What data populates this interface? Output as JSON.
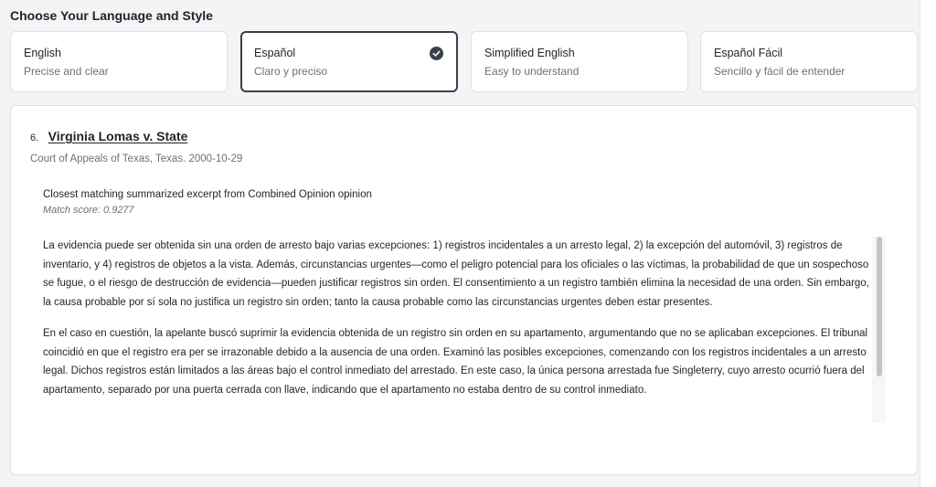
{
  "header": {
    "title": "Choose Your Language and Style"
  },
  "options": [
    {
      "title": "English",
      "subtitle": "Precise and clear",
      "selected": false
    },
    {
      "title": "Español",
      "subtitle": "Claro y preciso",
      "selected": true
    },
    {
      "title": "Simplified English",
      "subtitle": "Easy to understand",
      "selected": false
    },
    {
      "title": "Español Fácil",
      "subtitle": "Sencillo y fácil de entender",
      "selected": false
    }
  ],
  "case": {
    "number": "6.",
    "title": "Virginia Lomas v. State",
    "meta": "Court of Appeals of Texas, Texas. 2000-10-29",
    "excerpt_heading": "Closest matching summarized excerpt from Combined Opinion opinion",
    "match_score": "Match score: 0.9277",
    "paragraphs": [
      "La evidencia puede ser obtenida sin una orden de arresto bajo varias excepciones: 1) registros incidentales a un arresto legal, 2) la excepción del automóvil, 3) registros de inventario, y 4) registros de objetos a la vista. Además, circunstancias urgentes—como el peligro potencial para los oficiales o las víctimas, la probabilidad de que un sospechoso se fugue, o el riesgo de destrucción de evidencia—pueden justificar registros sin orden. El consentimiento a un registro también elimina la necesidad de una orden. Sin embargo, la causa probable por sí sola no justifica un registro sin orden; tanto la causa probable como las circunstancias urgentes deben estar presentes.",
      "En el caso en cuestión, la apelante buscó suprimir la evidencia obtenida de un registro sin orden en su apartamento, argumentando que no se aplicaban excepciones. El tribunal coincidió en que el registro era per se irrazonable debido a la ausencia de una orden. Examinó las posibles excepciones, comenzando con los registros incidentales a un arresto legal. Dichos registros están limitados a las áreas bajo el control inmediato del arrestado. En este caso, la única persona arrestada fue Singleterry, cuyo arresto ocurrió fuera del apartamento, separado por una puerta cerrada con llave, indicando que el apartamento no estaba dentro de su control inmediato."
    ]
  },
  "icons": {
    "selected": "check-circle-icon"
  },
  "colors": {
    "selected_border": "#3a3f4a",
    "muted_text": "#6b7078",
    "check_fill": "#3a3f4a"
  }
}
